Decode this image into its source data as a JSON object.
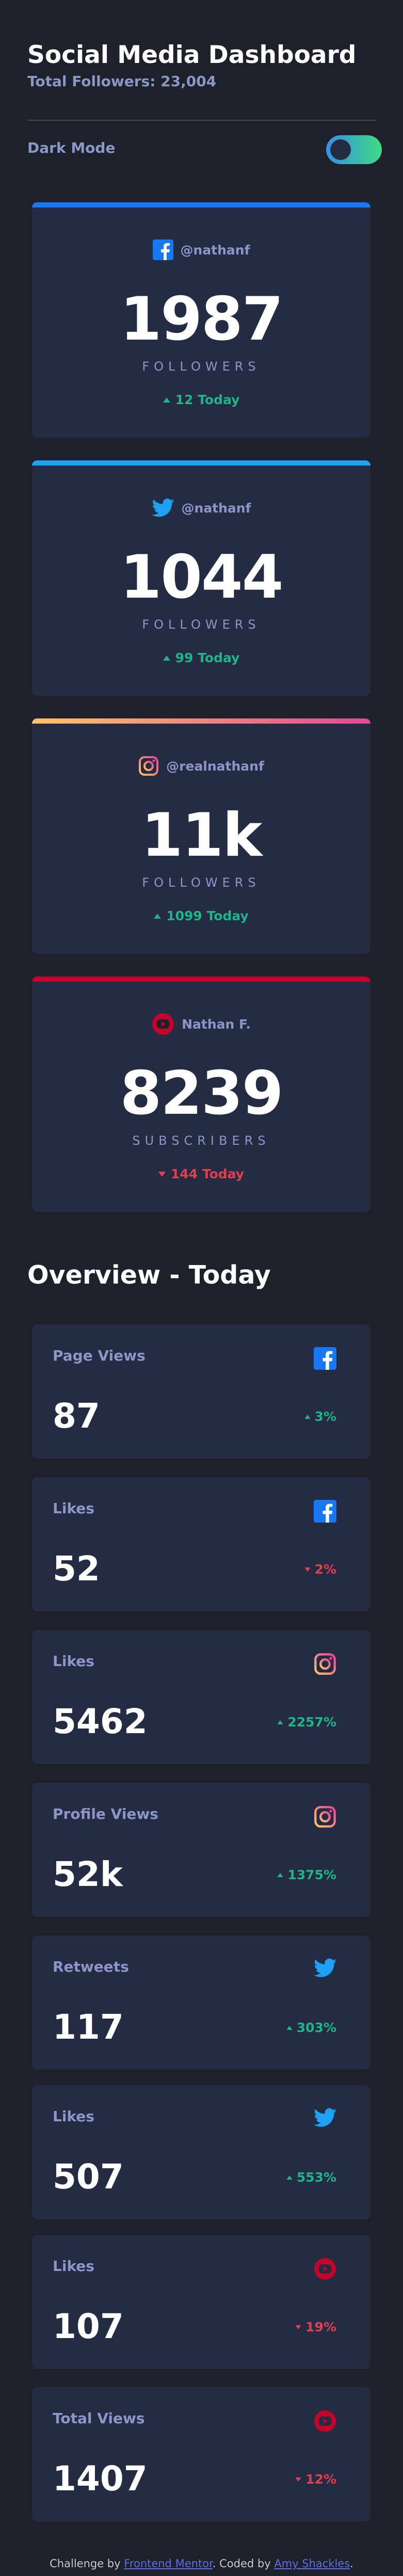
{
  "header": {
    "title": "Social Media Dashboard",
    "subtitle": "Total Followers: 23,004"
  },
  "dark_mode": {
    "label": "Dark Mode",
    "enabled": true
  },
  "colors": {
    "facebook": "#1877f2",
    "twitter": "#1da1f2",
    "instagram_gradient": [
      "#fdc468",
      "#df4996"
    ],
    "youtube": "#c4032b",
    "up": "#1eb589",
    "down": "#dc414c"
  },
  "follower_cards": [
    {
      "platform": "facebook",
      "icon": "facebook-icon",
      "handle": "@nathanf",
      "count": "1987",
      "label": "FOLLOWERS",
      "change": "12 Today",
      "trend": "up"
    },
    {
      "platform": "twitter",
      "icon": "twitter-icon",
      "handle": "@nathanf",
      "count": "1044",
      "label": "FOLLOWERS",
      "change": "99 Today",
      "trend": "up"
    },
    {
      "platform": "instagram",
      "icon": "instagram-icon",
      "handle": "@realnathanf",
      "count": "11k",
      "label": "FOLLOWERS",
      "change": "1099 Today",
      "trend": "up"
    },
    {
      "platform": "youtube",
      "icon": "youtube-icon",
      "handle": "Nathan F.",
      "count": "8239",
      "label": "SUBSCRIBERS",
      "change": "144 Today",
      "trend": "down"
    }
  ],
  "overview": {
    "title": "Overview - Today",
    "cards": [
      {
        "label": "Page Views",
        "icon": "facebook-icon",
        "value": "87",
        "change": "3%",
        "trend": "up"
      },
      {
        "label": "Likes",
        "icon": "facebook-icon",
        "value": "52",
        "change": "2%",
        "trend": "down"
      },
      {
        "label": "Likes",
        "icon": "instagram-icon",
        "value": "5462",
        "change": "2257%",
        "trend": "up"
      },
      {
        "label": "Profile Views",
        "icon": "instagram-icon",
        "value": "52k",
        "change": "1375%",
        "trend": "up"
      },
      {
        "label": "Retweets",
        "icon": "twitter-icon",
        "value": "117",
        "change": "303%",
        "trend": "up"
      },
      {
        "label": "Likes",
        "icon": "twitter-icon",
        "value": "507",
        "change": "553%",
        "trend": "up"
      },
      {
        "label": "Likes",
        "icon": "youtube-icon",
        "value": "107",
        "change": "19%",
        "trend": "down"
      },
      {
        "label": "Total Views",
        "icon": "youtube-icon",
        "value": "1407",
        "change": "12%",
        "trend": "down"
      }
    ]
  },
  "footer": {
    "prefix": "Challenge by ",
    "link1": "Frontend Mentor",
    "middle": ". Coded by ",
    "link2": "Amy Shackles",
    "suffix": "."
  }
}
